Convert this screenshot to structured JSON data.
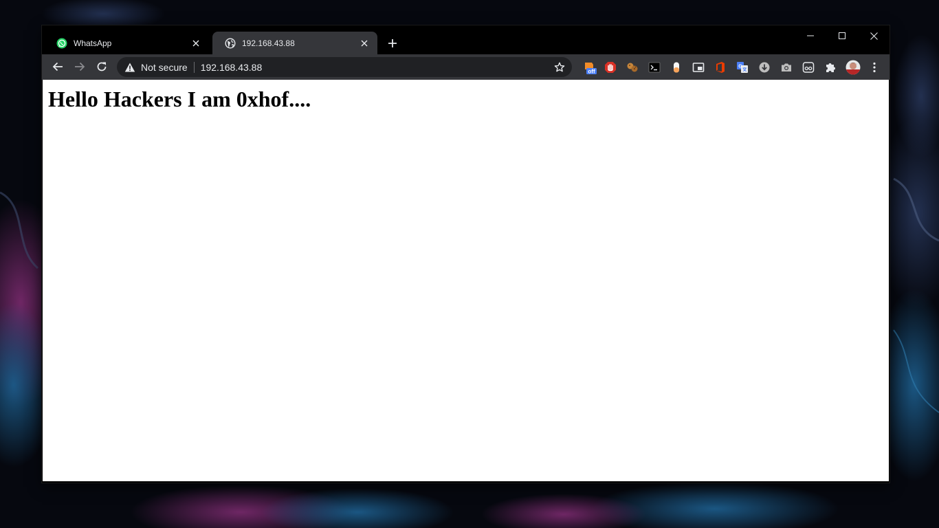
{
  "browser": {
    "tabs": [
      {
        "title": "WhatsApp",
        "favicon": "whatsapp-icon",
        "active": false
      },
      {
        "title": "192.168.43.88",
        "favicon": "globe-icon",
        "active": true
      }
    ],
    "new_tab_icon": "plus-icon",
    "window_controls": [
      "minimize-icon",
      "maximize-icon",
      "close-icon"
    ]
  },
  "toolbar": {
    "nav_icons": [
      "arrow-left-icon",
      "arrow-right-icon",
      "reload-icon"
    ],
    "security_icon": "warning-triangle-icon",
    "security_label": "Not secure",
    "url": "192.168.43.88",
    "bookmark_icon": "star-outline-icon",
    "extensions": [
      {
        "name": "tamper-extension-icon",
        "badge": "off",
        "color": "#f28c28"
      },
      {
        "name": "adblock-hand-icon",
        "color": "#d93025"
      },
      {
        "name": "cookie-icon",
        "color": "#c7863b"
      },
      {
        "name": "terminal-icon",
        "color": "#e8eaed"
      },
      {
        "name": "capsule-icon",
        "color": "#f6a35a"
      },
      {
        "name": "picture-in-picture-icon",
        "color": "#e8eaed"
      },
      {
        "name": "office-icon",
        "color": "#eb3c00"
      },
      {
        "name": "google-translate-icon",
        "color": "#4a7ef5"
      },
      {
        "name": "download-icon",
        "color": "#e8eaed"
      },
      {
        "name": "camera-icon",
        "color": "#e8eaed"
      },
      {
        "name": "reader-glasses-icon",
        "color": "#e8eaed"
      },
      {
        "name": "puzzle-extensions-icon",
        "color": "#e8eaed"
      },
      {
        "name": "profile-avatar",
        "color": "#c98d7a"
      },
      {
        "name": "kebab-menu-icon",
        "color": "#e8eaed"
      }
    ]
  },
  "page": {
    "heading": "Hello Hackers I am 0xhof...."
  },
  "colors": {
    "frame": "#000000",
    "toolbar": "#35363a",
    "omnibox": "#202124",
    "text": "#e8eaed",
    "page_bg": "#ffffff"
  }
}
